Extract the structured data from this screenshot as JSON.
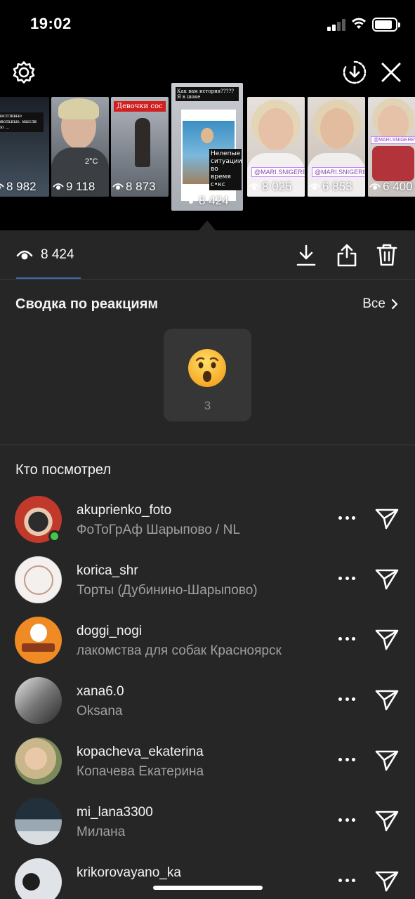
{
  "status": {
    "time": "19:02",
    "battery_level": 0.85
  },
  "thumbnails": [
    {
      "views": "8 982",
      "caption": "счастливые довольные. мысли про ...",
      "bg": "#3a4a5a"
    },
    {
      "views": "9 118",
      "caption": "2°C",
      "bg": "#7a7f86"
    },
    {
      "views": "8 873",
      "caption": "Девочки сос",
      "bg": "#8c8f98"
    },
    {
      "views": "8 424",
      "caption": "Как вам история????? Я в шоке",
      "caption2": "Нелепые ситуации во время с•кс",
      "bg": "#b9bcc2",
      "active": true
    },
    {
      "views": "8 025",
      "handle": "@MARI.SNIGEREVA",
      "bg": "#d8d2cc"
    },
    {
      "views": "6 853",
      "handle": "@MARI.SNIGEREVA",
      "bg": "#cfc6bf"
    },
    {
      "views": "6 400",
      "handle": "@MARI.SNIGEREVA",
      "bg": "#d0cbc8"
    }
  ],
  "stats": {
    "views": "8 424"
  },
  "reactions": {
    "title": "Сводка по реакциям",
    "see_all": "Все",
    "items": [
      {
        "emoji": "surprised-face",
        "count": "3"
      }
    ]
  },
  "viewers_title": "Кто посмотрел",
  "viewers": [
    {
      "username": "akuprienko_foto",
      "subtitle": "ФоТоГрАф Шарыпово / NL",
      "avatar_color": "#c0392b",
      "online": true
    },
    {
      "username": "korica_shr",
      "subtitle": "Торты (Дубинино-Шарыпово)",
      "avatar_color": "#f4f0ee",
      "online": false
    },
    {
      "username": "doggi_nogi",
      "subtitle": "лакомства для собак Красноярск",
      "avatar_color": "#f08a24",
      "online": false
    },
    {
      "username": "xana6.0",
      "subtitle": "Oksana",
      "avatar_color": "#777777",
      "online": false
    },
    {
      "username": "kopacheva_ekaterina",
      "subtitle": "Копачева Екатерина",
      "avatar_color": "#c9b68a",
      "online": false
    },
    {
      "username": "mi_lana3300",
      "subtitle": "Милана",
      "avatar_color": "#5a6b7a",
      "online": false
    },
    {
      "username": "krikorovayano_ka",
      "subtitle": "",
      "avatar_color": "#aab0b6",
      "online": false
    }
  ]
}
